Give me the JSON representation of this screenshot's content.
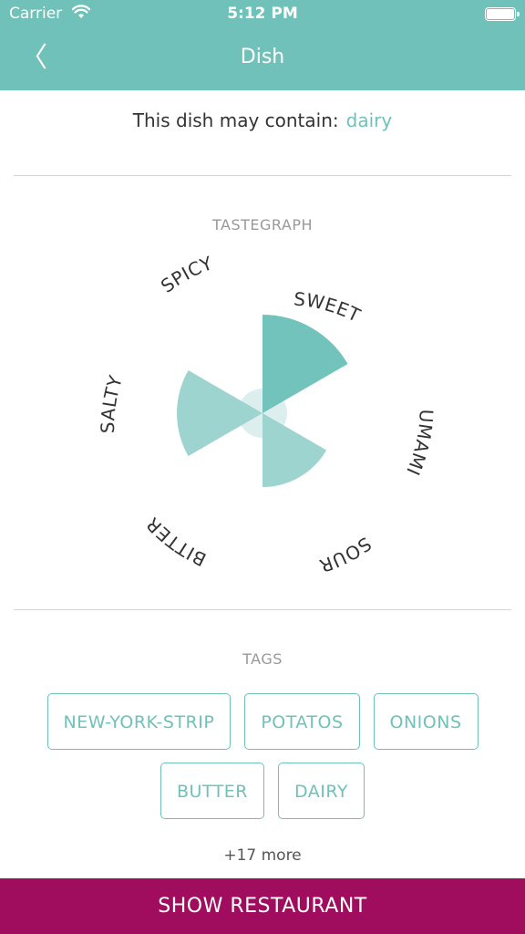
{
  "status_bar": {
    "carrier": "Carrier",
    "wifi_icon": "wifi-icon",
    "time": "5:12 PM",
    "battery_icon": "battery-icon"
  },
  "nav": {
    "back_icon": "chevron-left-icon",
    "back_glyph": "〈",
    "title": "Dish"
  },
  "allergen": {
    "prefix": "This dish may contain:",
    "value": "dairy"
  },
  "tastegraph": {
    "title": "TASTEGRAPH"
  },
  "chart_data": {
    "type": "radar-sectors",
    "axes": [
      "SWEET",
      "UMAMI",
      "SOUR",
      "BITTER",
      "SALTY",
      "SPICY"
    ],
    "values": [
      1.0,
      0,
      0.75,
      0,
      0.87,
      0
    ],
    "max": 1,
    "colors": {
      "SWEET": "#72c3bc",
      "SOUR": "#9dd4cf",
      "SALTY": "#9dd4cf",
      "center": "#dceeed"
    }
  },
  "tags_section": {
    "title": "TAGS",
    "rows": [
      [
        "NEW-YORK-STRIP",
        "POTATOS",
        "ONIONS"
      ],
      [
        "BUTTER",
        "DAIRY"
      ]
    ],
    "more": "+17 more"
  },
  "footer": {
    "button_label": "SHOW RESTAURANT"
  },
  "colors": {
    "header": "#70c1b9",
    "accent": "#70c1b9",
    "footer": "#a00d5e"
  }
}
